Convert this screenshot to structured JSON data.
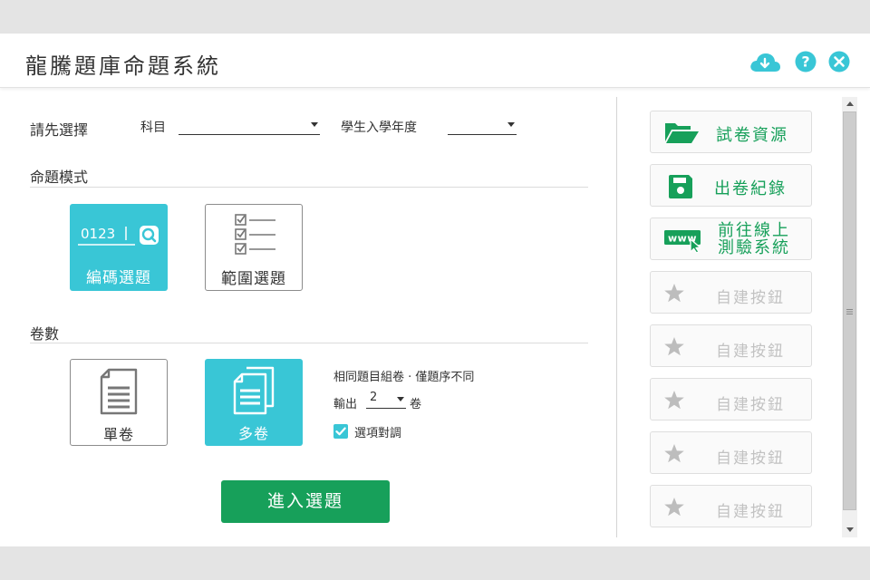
{
  "app": {
    "title": "龍騰題庫命題系統"
  },
  "titlebar_icons": [
    "cloud-download-icon",
    "help-icon",
    "close-icon"
  ],
  "colors": {
    "accent_teal": "#39c6d6",
    "brand_green": "#17a05a",
    "disabled_gray": "#c2c2c2"
  },
  "selection": {
    "prompt": "請先選擇",
    "subject_label": "科目",
    "subject_value": "",
    "enroll_year_label": "學生入學年度",
    "enroll_year_value": ""
  },
  "mode": {
    "heading": "命題模式",
    "code_tile": {
      "label": "編碼選題",
      "icon_text": "0123",
      "active": true
    },
    "range_tile": {
      "label": "範圍選題",
      "active": false
    }
  },
  "volumes": {
    "heading": "卷數",
    "single_tile": {
      "label": "單卷",
      "active": false
    },
    "multi_tile": {
      "label": "多卷",
      "active": true
    },
    "note": "相同題目組卷 · 僅題序不同",
    "output_label": "輸出",
    "output_count": "2",
    "output_unit": "卷",
    "shuffle_options_label": "選項對調",
    "shuffle_options_checked": true
  },
  "enter_button": {
    "label": "進入選題"
  },
  "sidebar": {
    "buttons": [
      {
        "label": "試卷資源",
        "icon": "folder-open-icon",
        "enabled": true
      },
      {
        "label": "出卷紀錄",
        "icon": "save-disk-icon",
        "enabled": true
      },
      {
        "label": "前往線上",
        "label2": "測驗系統",
        "icon": "www-link-icon",
        "enabled": true
      },
      {
        "label": "自建按鈕",
        "icon": "star-icon",
        "enabled": false
      },
      {
        "label": "自建按鈕",
        "icon": "star-icon",
        "enabled": false
      },
      {
        "label": "自建按鈕",
        "icon": "star-icon",
        "enabled": false
      },
      {
        "label": "自建按鈕",
        "icon": "star-icon",
        "enabled": false
      },
      {
        "label": "自建按鈕",
        "icon": "star-icon",
        "enabled": false
      }
    ]
  }
}
